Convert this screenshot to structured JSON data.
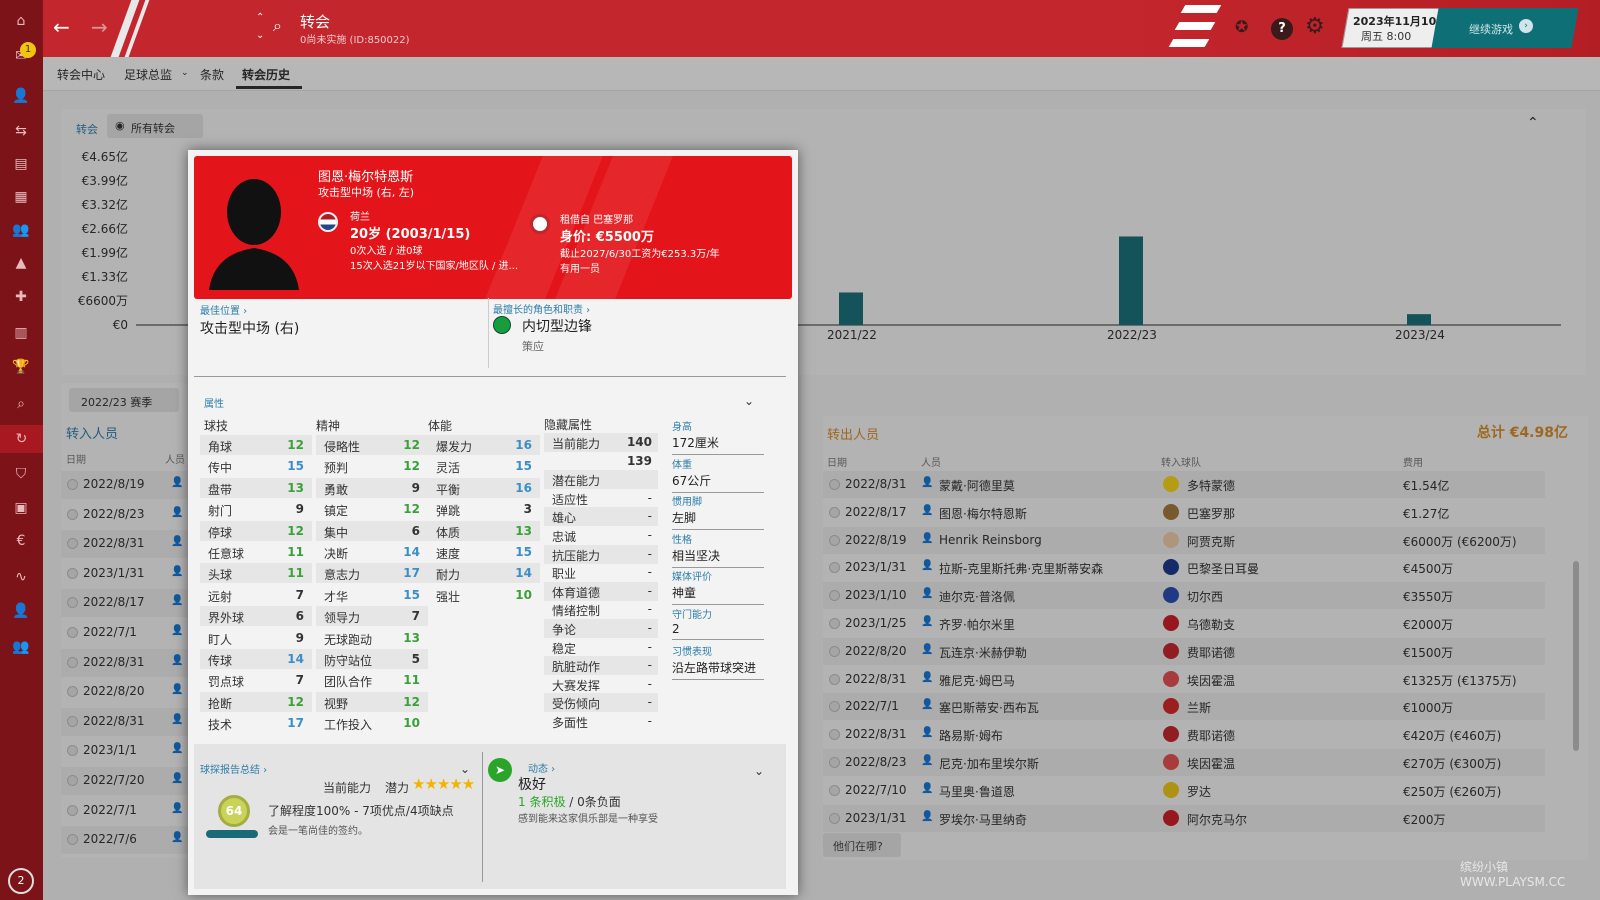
{
  "window": {
    "title": "转会",
    "subtitle": "0尚未实施 (ID:850022)",
    "date": "2023年11月10日",
    "time": "周五 8:00",
    "continue": "继续游戏",
    "notif_count": "1",
    "bottom_badge": "2"
  },
  "subnav": [
    "转会中心",
    "足球总监",
    "条款",
    "转会历史"
  ],
  "filter": {
    "label": "转会",
    "selected": "所有转会"
  },
  "chart": {
    "yticks": [
      "€4.65亿",
      "€3.99亿",
      "€3.32亿",
      "€2.66亿",
      "€1.99亿",
      "€1.33亿",
      "€6600万",
      "€0"
    ],
    "xticks": [
      "2021/22",
      "2022/23",
      "2023/24"
    ]
  },
  "chart_data": {
    "type": "bar",
    "categories": [
      "2021/22",
      "2022/23",
      "2023/24"
    ],
    "series": [
      {
        "name": "",
        "values": [
          0.9,
          2.45,
          0.3
        ]
      }
    ],
    "ylim": [
      0,
      4.65
    ],
    "ylabel": "",
    "xlabel": ""
  },
  "season": "2022/23 赛季",
  "in_title": "转入人员",
  "in_cols": [
    "日期",
    "人员"
  ],
  "in_rows": [
    "2022/8/19",
    "2022/8/23",
    "2022/8/31",
    "2023/1/31",
    "2022/8/17",
    "2022/7/1",
    "2022/8/31",
    "2022/8/20",
    "2022/8/31",
    "2023/1/1",
    "2022/7/20",
    "2022/7/1",
    "2022/7/6"
  ],
  "out_title": "转出人员",
  "out_total": "总计 €4.98亿",
  "out_cols": [
    "日期",
    "人员",
    "转入球队",
    "费用"
  ],
  "out_rows": [
    {
      "date": "2022/8/31",
      "name": "蒙戴·阿德里莫",
      "club": "多特蒙德",
      "fee": "€1.54亿",
      "color": "#f1d21b"
    },
    {
      "date": "2022/8/17",
      "name": "图恩·梅尔特恩斯",
      "club": "巴塞罗那",
      "fee": "€1.27亿",
      "color": "#a0763c"
    },
    {
      "date": "2022/8/19",
      "name": "Henrik Reinsborg",
      "club": "阿贾克斯",
      "fee": "€6000万 (€6200万)",
      "color": "#e8c7a6"
    },
    {
      "date": "2023/1/31",
      "name": "拉斯-克里斯托弗·克里斯蒂安森",
      "club": "巴黎圣日耳曼",
      "fee": "€4500万",
      "color": "#1c3a8a"
    },
    {
      "date": "2023/1/10",
      "name": "迪尔克·普洛佩",
      "club": "切尔西",
      "fee": "€3550万",
      "color": "#2a4cb0"
    },
    {
      "date": "2023/1/25",
      "name": "齐罗·帕尔米里",
      "club": "乌德勒支",
      "fee": "€2000万",
      "color": "#c82028"
    },
    {
      "date": "2022/8/20",
      "name": "瓦连京·米赫伊勒",
      "club": "费耶诺德",
      "fee": "€1500万",
      "color": "#c0272d"
    },
    {
      "date": "2022/8/31",
      "name": "雅尼克·姆巴马",
      "club": "埃因霍温",
      "fee": "€1325万 (€1375万)",
      "color": "#e05050"
    },
    {
      "date": "2022/7/1",
      "name": "塞巴斯蒂安·西布瓦",
      "club": "兰斯",
      "fee": "€1000万",
      "color": "#d02a2a"
    },
    {
      "date": "2022/8/31",
      "name": "路易斯·姆布",
      "club": "费耶诺德",
      "fee": "€420万 (€460万)",
      "color": "#c0272d"
    },
    {
      "date": "2022/8/23",
      "name": "尼克·加布里埃尔斯",
      "club": "埃因霍温",
      "fee": "€270万 (€300万)",
      "color": "#e05050"
    },
    {
      "date": "2022/7/10",
      "name": "马里奥·鲁道恩",
      "club": "罗达",
      "fee": "€250万 (€260万)",
      "color": "#e7c31a"
    },
    {
      "date": "2023/1/31",
      "name": "罗埃尔·马里纳奇",
      "club": "阿尔克马尔",
      "fee": "€200万",
      "color": "#c82028"
    }
  ],
  "where": "他们在哪?",
  "player": {
    "name": "图恩·梅尔特恩斯",
    "role": "攻击型中场 (右, 左)",
    "nation": "荷兰",
    "age": "20岁 (2003/1/15)",
    "caps": "0次入选 / 进0球",
    "youth": "15次入选21岁以下国家/地区队 / 进...",
    "loan": "租借自 巴塞罗那",
    "value": "身价: €5500万",
    "contract": "截止2027/6/30工资为€253.3万/年",
    "status": "有用一员"
  },
  "best_pos": {
    "label": "最佳位置",
    "value": "攻击型中场 (右)"
  },
  "best_role": {
    "label": "最擅长的角色和职责",
    "value": "内切型边锋",
    "duty": "策应"
  },
  "attr_label": "属性",
  "tech_h": "球技",
  "ment_h": "精神",
  "phys_h": "体能",
  "hid_h": "隐藏属性",
  "tech": [
    [
      "角球",
      "12",
      "g"
    ],
    [
      "传中",
      "15",
      "b"
    ],
    [
      "盘带",
      "13",
      "g"
    ],
    [
      "射门",
      "9",
      "k"
    ],
    [
      "停球",
      "12",
      "g"
    ],
    [
      "任意球",
      "11",
      "g"
    ],
    [
      "头球",
      "11",
      "g"
    ],
    [
      "远射",
      "7",
      "k"
    ],
    [
      "界外球",
      "6",
      "k"
    ],
    [
      "盯人",
      "9",
      "k"
    ],
    [
      "传球",
      "14",
      "b"
    ],
    [
      "罚点球",
      "7",
      "k"
    ],
    [
      "抢断",
      "12",
      "g"
    ],
    [
      "技术",
      "17",
      "b"
    ]
  ],
  "ment": [
    [
      "侵略性",
      "12",
      "g"
    ],
    [
      "预判",
      "12",
      "g"
    ],
    [
      "勇敢",
      "9",
      "k"
    ],
    [
      "镇定",
      "12",
      "g"
    ],
    [
      "集中",
      "6",
      "k"
    ],
    [
      "决断",
      "14",
      "b"
    ],
    [
      "意志力",
      "17",
      "b"
    ],
    [
      "才华",
      "15",
      "b"
    ],
    [
      "领导力",
      "7",
      "k"
    ],
    [
      "无球跑动",
      "13",
      "g"
    ],
    [
      "防守站位",
      "5",
      "k"
    ],
    [
      "团队合作",
      "11",
      "g"
    ],
    [
      "视野",
      "12",
      "g"
    ],
    [
      "工作投入",
      "10",
      "g"
    ]
  ],
  "phys": [
    [
      "爆发力",
      "16",
      "b"
    ],
    [
      "灵活",
      "15",
      "b"
    ],
    [
      "平衡",
      "16",
      "b"
    ],
    [
      "弹跳",
      "3",
      "k"
    ],
    [
      "体质",
      "13",
      "g"
    ],
    [
      "速度",
      "15",
      "b"
    ],
    [
      "耐力",
      "14",
      "b"
    ],
    [
      "强壮",
      "10",
      "g"
    ]
  ],
  "hidden": [
    [
      "当前能力",
      "140"
    ],
    [
      "",
      "139"
    ],
    [
      "潜在能力",
      ""
    ],
    [
      "适应性",
      "-"
    ],
    [
      "雄心",
      "-"
    ],
    [
      "忠诚",
      "-"
    ],
    [
      "抗压能力",
      "-"
    ],
    [
      "职业",
      "-"
    ],
    [
      "体育道德",
      "-"
    ],
    [
      "情绪控制",
      "-"
    ],
    [
      "争论",
      "-"
    ],
    [
      "稳定",
      "-"
    ],
    [
      "肮脏动作",
      "-"
    ],
    [
      "大赛发挥",
      "-"
    ],
    [
      "受伤倾向",
      "-"
    ],
    [
      "多面性",
      "-"
    ]
  ],
  "info": [
    [
      "身高",
      "172厘米"
    ],
    [
      "体重",
      "67公斤"
    ],
    [
      "惯用脚",
      "左脚"
    ],
    [
      "性格",
      "相当坚决"
    ],
    [
      "媒体评价",
      "神童"
    ],
    [
      "守门能力",
      "2"
    ],
    [
      "习惯表现",
      "沿左路带球突进"
    ]
  ],
  "scout": {
    "label": "球探报告总结",
    "ca": "当前能力",
    "pa": "潜力",
    "rating": "64",
    "known": "了解程度100% - 7项优点/4项缺点",
    "note": "会是一笔尚佳的签约。",
    "stars": "★★★★★"
  },
  "dyn": {
    "label": "动态",
    "mood": "极好",
    "pos": "1 条积极",
    "sep": " / ",
    "neg": "0条负面",
    "note": "感到能来这家俱乐部是一种享受"
  },
  "watermark": "缤纷小镇 WWW.PLAYSM.CC"
}
